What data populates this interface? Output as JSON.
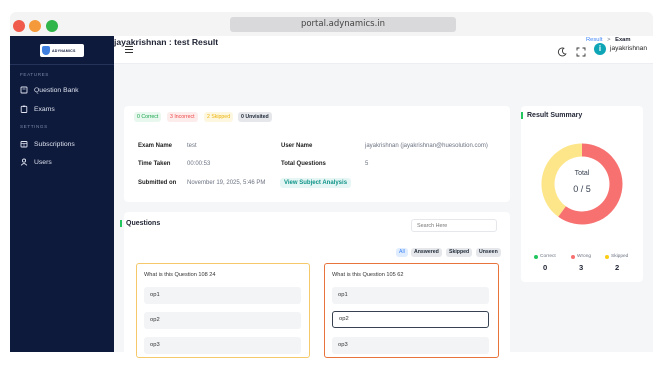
{
  "browser": {
    "url": "portal.adynamics.in"
  },
  "brand": {
    "logo_text": "ADYNAMICS"
  },
  "sidebar": {
    "section_features": "FEATURES",
    "section_settings": "SETTINGS",
    "items": [
      {
        "label": "Question Bank",
        "icon": "book-icon"
      },
      {
        "label": "Exams",
        "icon": "clipboard-icon"
      },
      {
        "label": "Subscriptions",
        "icon": "calendar-icon"
      },
      {
        "label": "Users",
        "icon": "user-icon"
      }
    ]
  },
  "header": {
    "user_initial": "i",
    "user_name": "jayakrishnan"
  },
  "page": {
    "title": "jayakrishnan : test Result",
    "breadcrumb": {
      "parent": "Result",
      "separator": ">",
      "current": "Exam"
    }
  },
  "result": {
    "badges": {
      "correct": "0 Correct",
      "incorrect": "3 Incorrect",
      "skipped": "2 Skipped",
      "unvisited": "0 Unvisited"
    },
    "exam_name_label": "Exam Name",
    "exam_name": "test",
    "user_name_label": "User Name",
    "user_name": "jayakrishnan (jayakrishnan@huesolution.com)",
    "time_taken_label": "Time Taken",
    "time_taken": "00:00:53",
    "total_questions_label": "Total Questions",
    "total_questions": "5",
    "submitted_on_label": "Submitted on",
    "submitted_on": "November 19, 2025, 5:46 PM",
    "view_analysis": "View Subject Analysis"
  },
  "summary": {
    "title": "Result Summary",
    "center_label": "Total",
    "center_value": "0 / 5",
    "legend": [
      {
        "label": "Correct",
        "value": "0",
        "color": "#22c55e"
      },
      {
        "label": "Wrong",
        "value": "3",
        "color": "#f87171"
      },
      {
        "label": "Skipped",
        "value": "2",
        "color": "#facc15"
      }
    ]
  },
  "chart_data": {
    "type": "pie",
    "categories": [
      "Correct",
      "Wrong",
      "Skipped"
    ],
    "values": [
      0,
      3,
      2
    ],
    "colors": [
      "#22c55e",
      "#f87171",
      "#fde68a"
    ],
    "title": "Result Summary"
  },
  "questions": {
    "title": "Questions",
    "search_placeholder": "Search Here",
    "filters": [
      "All",
      "Answered",
      "Skipped",
      "Unseen"
    ],
    "cards": [
      {
        "text": "What is this Question 108 24",
        "status": "skipped",
        "options": [
          "op1",
          "op2",
          "op3"
        ],
        "selected": null
      },
      {
        "text": "What is this Question 105 62",
        "status": "wrong",
        "options": [
          "op1",
          "op2",
          "op3"
        ],
        "selected": "op2"
      }
    ]
  }
}
